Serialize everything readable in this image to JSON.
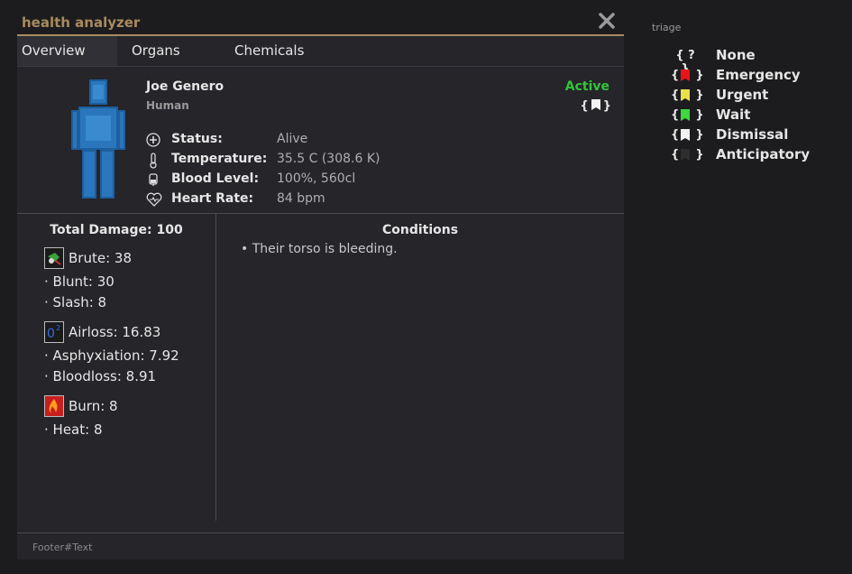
{
  "window": {
    "title": "health analyzer"
  },
  "tabs": [
    "Overview",
    "Organs",
    "Chemicals"
  ],
  "patient": {
    "name": "Joe Genero",
    "species": "Human",
    "state": "Active",
    "status_label": "Status:",
    "status_value": "Alive",
    "temp_label": "Temperature:",
    "temp_value": "35.5 C (308.6 K)",
    "blood_label": "Blood Level:",
    "blood_value": "100%, 560cl",
    "heart_label": "Heart Rate:",
    "heart_value": "84 bpm"
  },
  "damage": {
    "total": "Total Damage: 100",
    "groups": [
      {
        "label": "Brute: 38",
        "icon": "brute-icon",
        "subs": [
          "· Blunt: 30",
          "· Slash: 8"
        ]
      },
      {
        "label": "Airloss: 16.83",
        "icon": "airloss-icon",
        "subs": [
          "· Asphyxiation: 7.92",
          "· Bloodloss: 8.91"
        ]
      },
      {
        "label": "Burn: 8",
        "icon": "burn-icon",
        "subs": [
          "· Heat: 8"
        ]
      }
    ]
  },
  "conditions": {
    "title": "Conditions",
    "items": [
      "•  Their torso is bleeding."
    ]
  },
  "footer": "Footer#Text",
  "triage": {
    "title": "triage",
    "items": [
      {
        "label": "None",
        "color": ""
      },
      {
        "label": "Emergency",
        "color": "#e8141a"
      },
      {
        "label": "Urgent",
        "color": "#e8e04a"
      },
      {
        "label": "Wait",
        "color": "#3ed83e"
      },
      {
        "label": "Dismissal",
        "color": "#f2f2f2"
      },
      {
        "label": "Anticipatory",
        "color": "#2e2e2e"
      }
    ]
  }
}
